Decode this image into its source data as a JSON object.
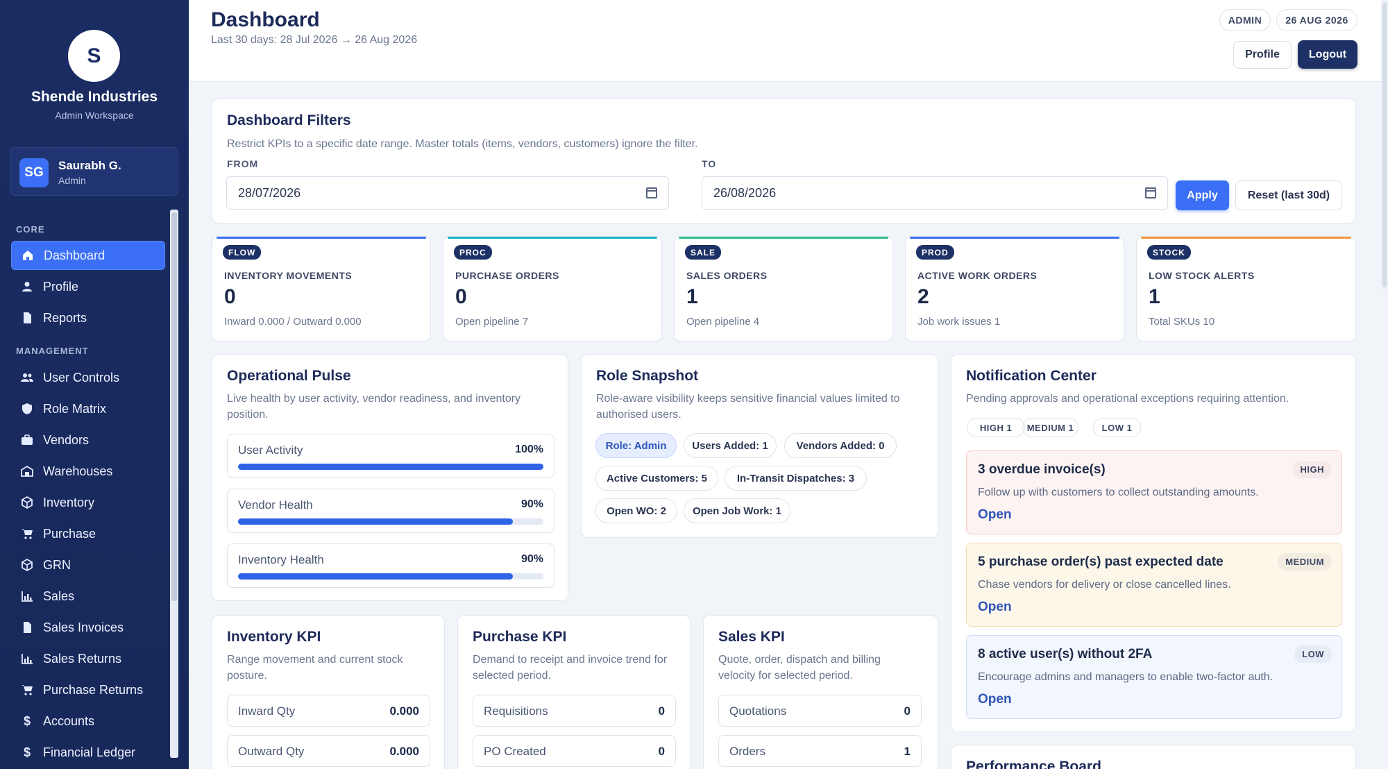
{
  "sidebar": {
    "logo_letter": "S",
    "company": "Shende Industries",
    "workspace": "Admin Workspace",
    "user": {
      "initials": "SG",
      "name": "Saurabh G.",
      "role": "Admin"
    },
    "sections": {
      "core": "CORE",
      "management": "MANAGEMENT"
    },
    "items": [
      {
        "label": "Dashboard",
        "icon": "home-icon"
      },
      {
        "label": "Profile",
        "icon": "user-icon"
      },
      {
        "label": "Reports",
        "icon": "document-icon"
      },
      {
        "label": "User Controls",
        "icon": "users-icon"
      },
      {
        "label": "Role Matrix",
        "icon": "shield-icon"
      },
      {
        "label": "Vendors",
        "icon": "briefcase-icon"
      },
      {
        "label": "Warehouses",
        "icon": "warehouse-icon"
      },
      {
        "label": "Inventory",
        "icon": "box-icon"
      },
      {
        "label": "Purchase",
        "icon": "cart-icon"
      },
      {
        "label": "GRN",
        "icon": "box-icon"
      },
      {
        "label": "Sales",
        "icon": "bar-chart-icon"
      },
      {
        "label": "Sales Invoices",
        "icon": "document-icon"
      },
      {
        "label": "Sales Returns",
        "icon": "bar-chart-icon"
      },
      {
        "label": "Purchase Returns",
        "icon": "cart-icon"
      },
      {
        "label": "Accounts",
        "icon": "dollar-icon"
      },
      {
        "label": "Financial Ledger",
        "icon": "dollar-icon"
      }
    ]
  },
  "header": {
    "title": "Dashboard",
    "subtitle": "Last 30 days: 28 Jul 2026 → 26 Aug 2026",
    "role_chip": "ADMIN",
    "date_chip": "26 AUG 2026",
    "profile_label": "Profile",
    "logout_label": "Logout"
  },
  "filters": {
    "title": "Dashboard Filters",
    "subtitle": "Restrict KPIs to a specific date range. Master totals (items, vendors, customers) ignore the filter.",
    "from_label": "FROM",
    "from_value": "28/07/2026",
    "to_label": "TO",
    "to_value": "26/08/2026",
    "apply_label": "Apply",
    "reset_label": "Reset (last 30d)"
  },
  "kpis": [
    {
      "tag": "FLOW",
      "label": "INVENTORY MOVEMENTS",
      "value": "0",
      "note": "Inward 0.000 / Outward 0.000",
      "color": "#3b6ff5"
    },
    {
      "tag": "PROC",
      "label": "PURCHASE ORDERS",
      "value": "0",
      "note": "Open pipeline 7",
      "color": "#1ab2c9"
    },
    {
      "tag": "SALE",
      "label": "SALES ORDERS",
      "value": "1",
      "note": "Open pipeline 4",
      "color": "#2fbf8c"
    },
    {
      "tag": "PROD",
      "label": "ACTIVE WORK ORDERS",
      "value": "2",
      "note": "Job work issues 1",
      "color": "#3b6ff5"
    },
    {
      "tag": "STOCK",
      "label": "LOW STOCK ALERTS",
      "value": "1",
      "note": "Total SKUs 10",
      "color": "#f29a3c"
    }
  ],
  "pulse": {
    "title": "Operational Pulse",
    "subtitle": "Live health by user activity, vendor readiness, and inventory position.",
    "metrics": [
      {
        "name": "User Activity",
        "value": "100%",
        "level": 100
      },
      {
        "name": "Vendor Health",
        "value": "90%",
        "level": 90
      },
      {
        "name": "Inventory Health",
        "value": "90%",
        "level": 90
      }
    ]
  },
  "roles": {
    "title": "Role Snapshot",
    "subtitle": "Role-aware visibility keeps sensitive financial values limited to authorised users.",
    "pills": [
      "Role: Admin",
      "Users Added: 1",
      "Vendors Added: 0",
      "Active Customers: 5",
      "In-Transit Dispatches: 3",
      "Open WO: 2",
      "Open Job Work: 1"
    ]
  },
  "notifications": {
    "title": "Notification Center",
    "subtitle": "Pending approvals and operational exceptions requiring attention.",
    "chips": [
      "HIGH 1",
      "MEDIUM 1",
      "LOW 1"
    ],
    "items": [
      {
        "title": "3 overdue invoice(s)",
        "desc": "Follow up with customers to collect outstanding amounts.",
        "open": "Open",
        "badge": "HIGH"
      },
      {
        "title": "5 purchase order(s) past expected date",
        "desc": "Chase vendors for delivery or close cancelled lines.",
        "open": "Open",
        "badge": "MEDIUM"
      },
      {
        "title": "8 active user(s) without 2FA",
        "desc": "Encourage admins and managers to enable two-factor auth.",
        "open": "Open",
        "badge": "LOW"
      }
    ]
  },
  "inventory_kpi": {
    "title": "Inventory KPI",
    "subtitle": "Range movement and current stock posture.",
    "rows": [
      {
        "name": "Inward Qty",
        "value": "0.000"
      },
      {
        "name": "Outward Qty",
        "value": "0.000"
      }
    ]
  },
  "purchase_kpi": {
    "title": "Purchase KPI",
    "subtitle": "Demand to receipt and invoice trend for selected period.",
    "rows": [
      {
        "name": "Requisitions",
        "value": "0"
      },
      {
        "name": "PO Created",
        "value": "0"
      }
    ]
  },
  "sales_kpi": {
    "title": "Sales KPI",
    "subtitle": "Quote, order, dispatch and billing velocity for selected period.",
    "rows": [
      {
        "name": "Quotations",
        "value": "0"
      },
      {
        "name": "Orders",
        "value": "1"
      }
    ]
  },
  "performance": {
    "title": "Performance Board"
  }
}
